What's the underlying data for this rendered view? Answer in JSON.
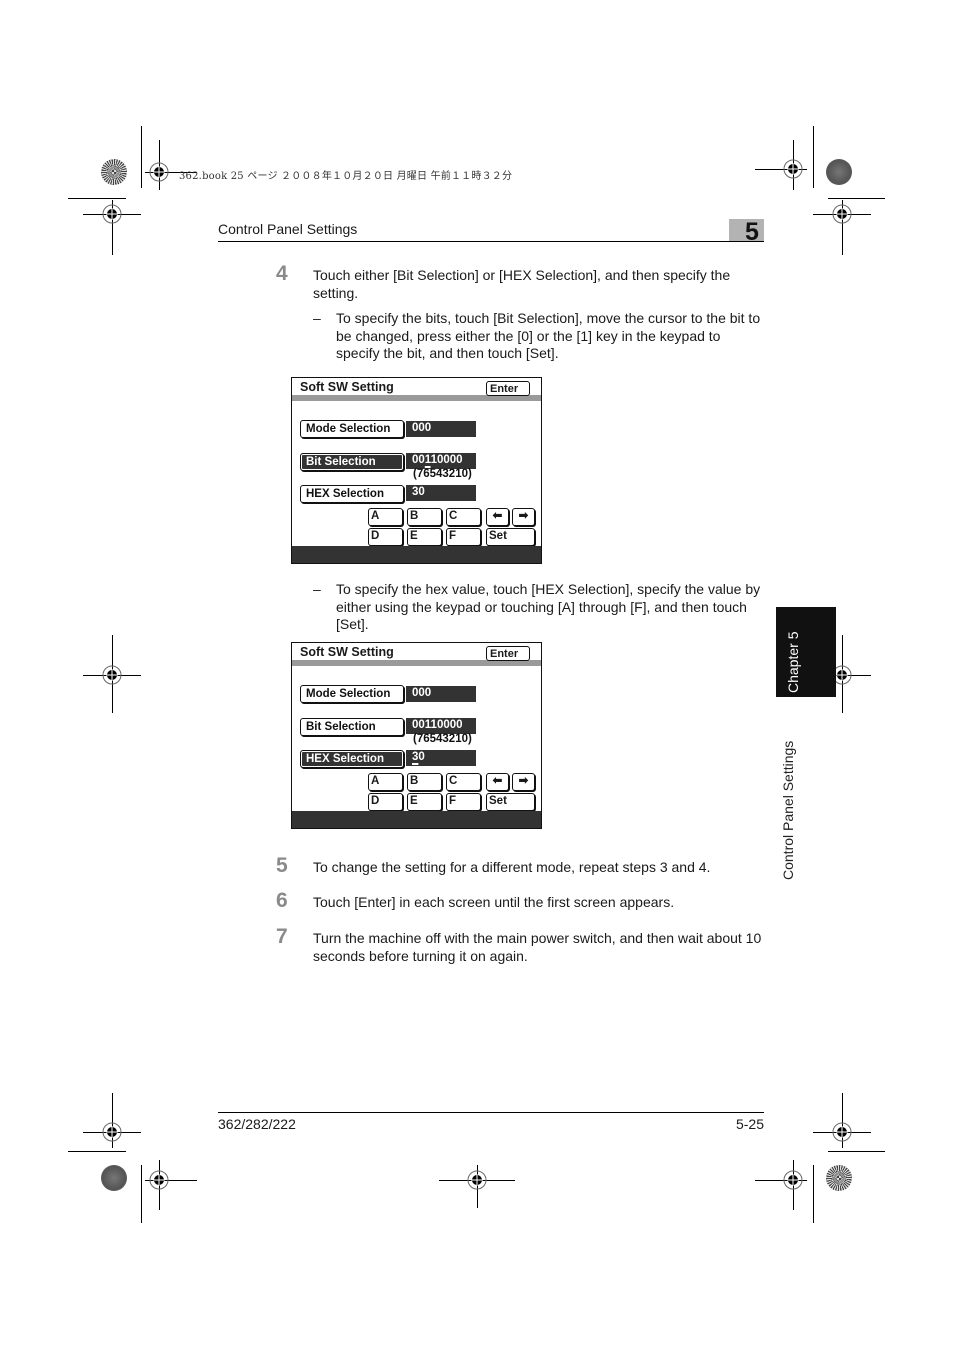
{
  "print_info": "362.book  25 ページ  ２００８年１０月２０日  月曜日  午前１１時３２分",
  "header": {
    "title": "Control Panel Settings",
    "chapter_number": "5"
  },
  "steps": [
    {
      "number": "4",
      "text": "Touch either [Bit Selection] or [HEX Selection], and then specify the setting.",
      "sub_items": [
        {
          "bullet": "–",
          "text": "To specify the bits, touch [Bit Selection], move the cursor to the bit to be changed, press either the [0] or the [1] key in the keypad to specify the bit, and then touch [Set]."
        },
        {
          "bullet": "–",
          "text": "To specify the hex value, touch [HEX Selection], specify the value by either using the keypad or touching [A] through [F], and then touch [Set]."
        }
      ]
    },
    {
      "number": "5",
      "text": "To change the setting for a different mode, repeat steps 3 and 4."
    },
    {
      "number": "6",
      "text": "Touch [Enter] in each screen until the first screen appears."
    },
    {
      "number": "7",
      "text": "Turn the machine off with the main power switch, and then wait about 10 seconds before turning it on again."
    }
  ],
  "screens": [
    {
      "title": "Soft SW Setting",
      "enter_label": "Enter",
      "active": "bit",
      "mode_label": "Mode Selection",
      "mode_value": "000",
      "bit_label": "Bit Selection",
      "bit_value_pre": "00",
      "bit_value_cursor": "1",
      "bit_value_post": "10000",
      "bit_legend": "(76543210)",
      "hex_label": "HEX Selection",
      "hex_value_cursor": "",
      "hex_value": "30",
      "keys": [
        "A",
        "B",
        "C",
        "D",
        "E",
        "F"
      ],
      "left_arrow_icon": "left-arrow",
      "right_arrow_icon": "right-arrow",
      "set_label": "Set"
    },
    {
      "title": "Soft SW Setting",
      "enter_label": "Enter",
      "active": "hex",
      "mode_label": "Mode Selection",
      "mode_value": "000",
      "bit_label": "Bit Selection",
      "bit_value": "00110000",
      "bit_legend": "(76543210)",
      "hex_label": "HEX Selection",
      "hex_value_cursor": "3",
      "hex_value_post": "0",
      "keys": [
        "A",
        "B",
        "C",
        "D",
        "E",
        "F"
      ],
      "left_arrow_icon": "left-arrow",
      "right_arrow_icon": "right-arrow",
      "set_label": "Set"
    }
  ],
  "side_tab": {
    "chapter": "Chapter 5",
    "section": "Control Panel Settings"
  },
  "footer": {
    "model": "362/282/222",
    "page": "5-25"
  },
  "colors": {
    "step_number": "#8a8a8a",
    "chapter_box": "#b3b3b3",
    "panel_dark": "#333333",
    "title_bar": "#9a9a9a"
  }
}
